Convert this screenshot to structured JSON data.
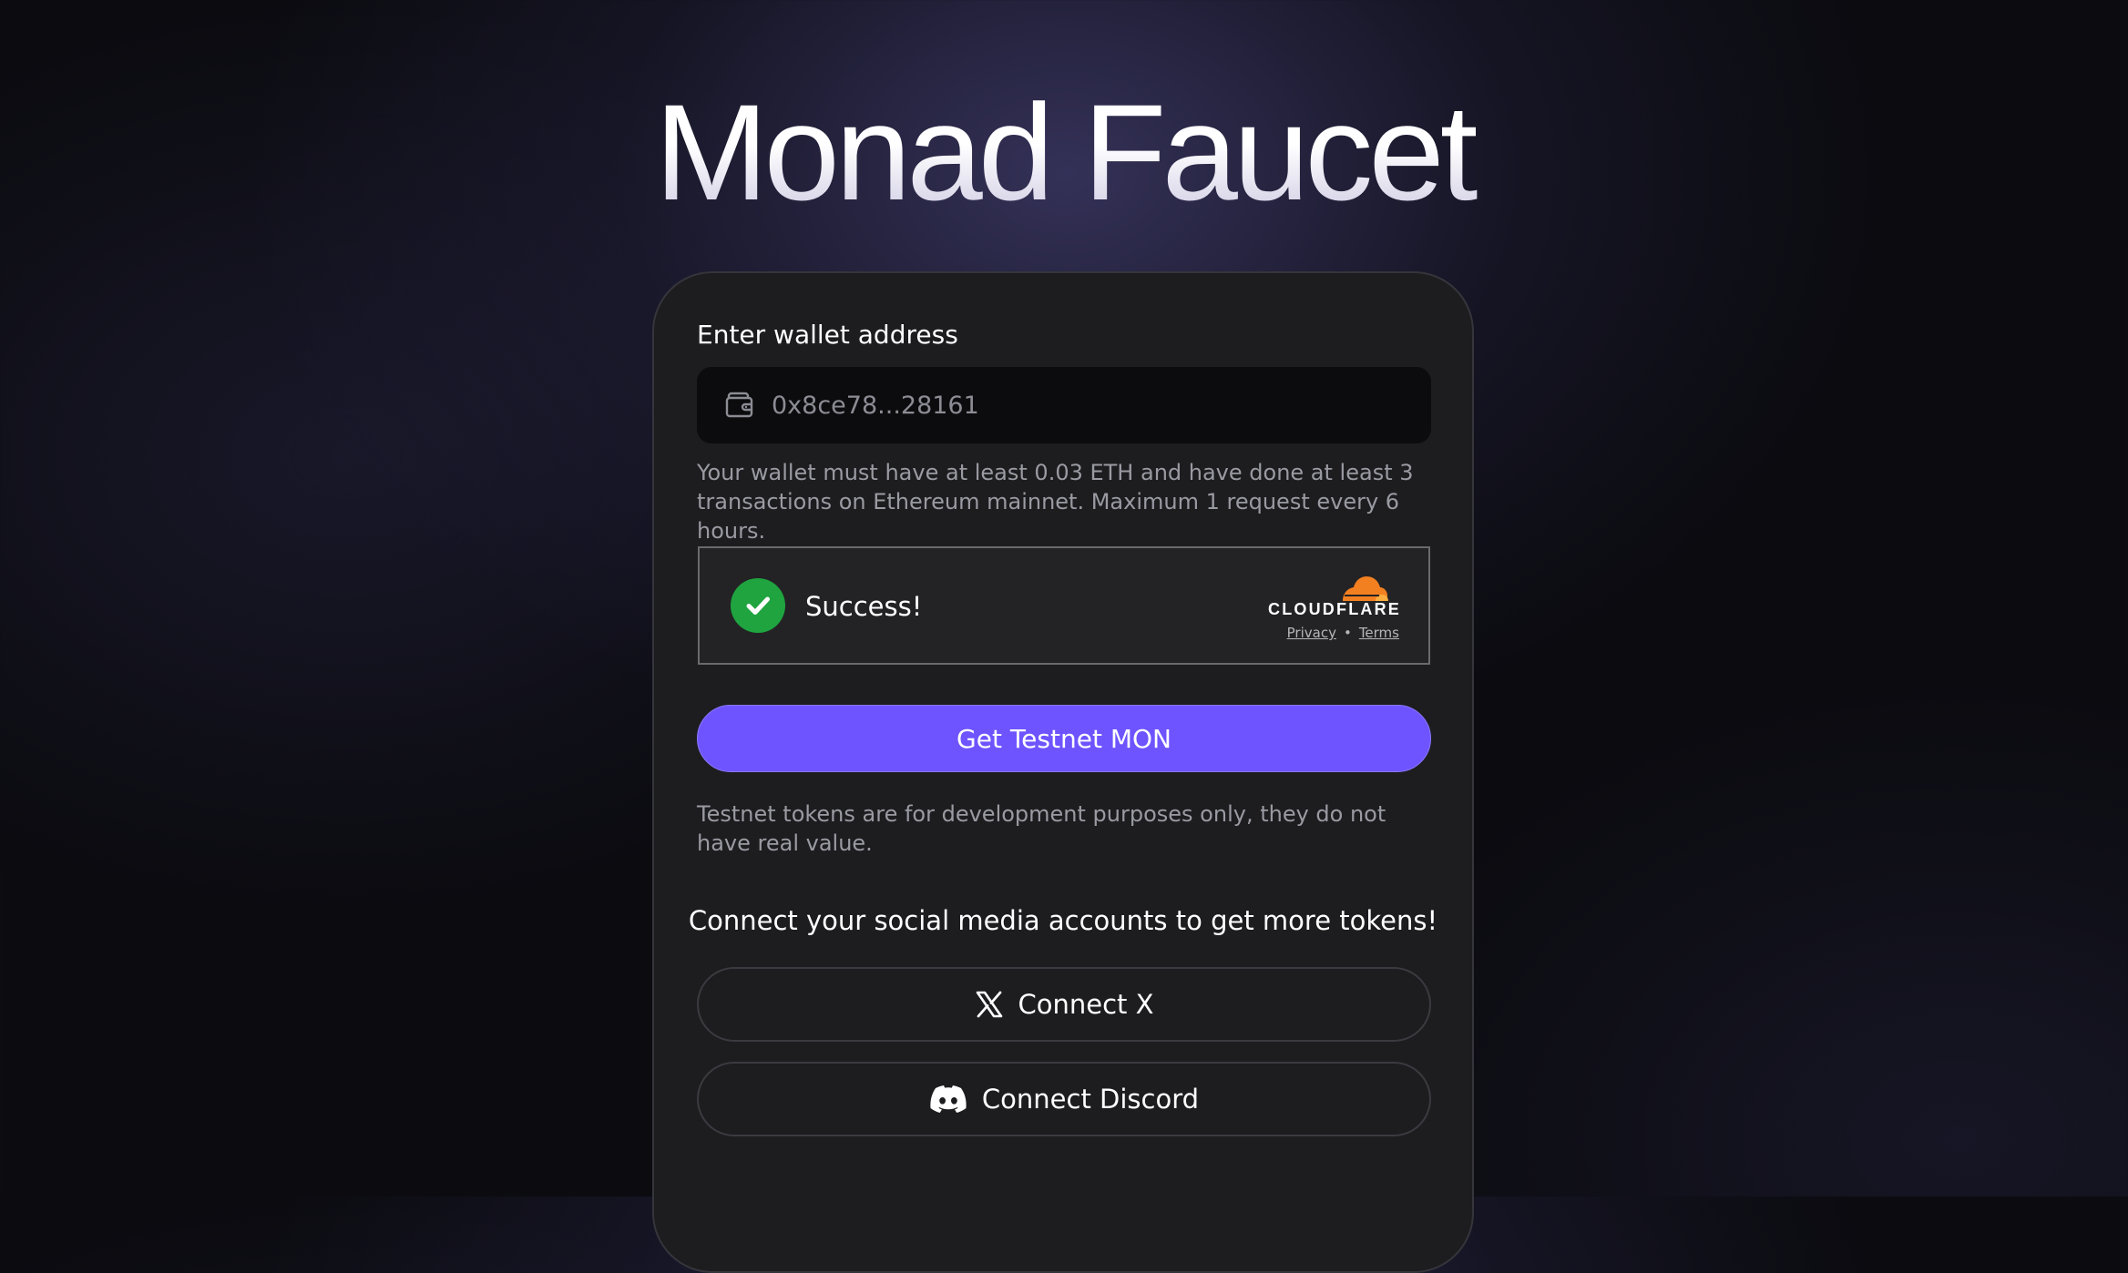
{
  "header": {
    "title": "Monad Faucet"
  },
  "form": {
    "label": "Enter wallet address",
    "wallet_input": {
      "value": "",
      "placeholder": "0x8ce78...28161",
      "icon": "wallet-icon"
    },
    "hint": "Your wallet must have at least 0.03 ETH and have done at least 3 transactions on Ethereum mainnet. Maximum 1 request every 6 hours."
  },
  "captcha": {
    "status_text": "Success!",
    "status_icon": "check-circle-icon",
    "provider": "CLOUDFLARE",
    "privacy_label": "Privacy",
    "separator": "•",
    "terms_label": "Terms"
  },
  "submit": {
    "label": "Get Testnet MON"
  },
  "disclaimer": "Testnet tokens are for development purposes only, they do not have real value.",
  "social": {
    "title": "Connect your social media accounts to get more tokens!",
    "buttons": [
      {
        "label": "Connect X",
        "icon": "x-logo-icon"
      },
      {
        "label": "Connect Discord",
        "icon": "discord-icon"
      }
    ]
  },
  "colors": {
    "accent": "#6E54FF",
    "success": "#1FA43F",
    "cloudflare_orange": "#F38020",
    "card_bg": "#1D1D20"
  }
}
